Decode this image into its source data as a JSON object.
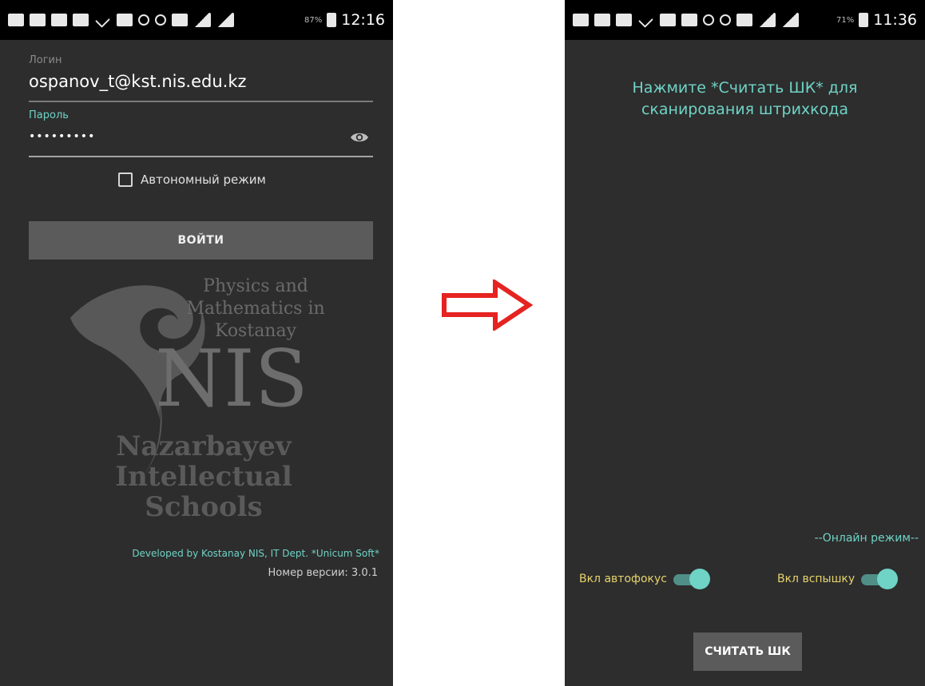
{
  "colors": {
    "background": "#2d2d2d",
    "accent_teal": "#6fd3c6",
    "toggle_label_yellow": "#e6d36d",
    "button_gray": "#5b5b5b",
    "arrow_red": "#e52321"
  },
  "left_screen": {
    "status_bar": {
      "time": "12:16",
      "battery": "87%"
    },
    "login": {
      "label": "Логин",
      "value": "ospanov_t@kst.nis.edu.kz"
    },
    "password": {
      "label": "Пароль",
      "value": "•••••••••",
      "visibility_icon": "eye-icon"
    },
    "offline_mode": {
      "label": "Автономный режим",
      "checked": false
    },
    "login_button": {
      "label": "ВОЙТИ"
    },
    "logo": {
      "physics_text": "Physics and Mathematics in Kostanay",
      "nis_text": "NIS",
      "nazarbayev_text": "Nazarbayev Intellectual Schools"
    },
    "footer": {
      "developed_by": "Developed by Kostanay NIS, IT Dept. *Unicum Soft*",
      "version": "Номер версии: 3.0.1"
    }
  },
  "arrow": {
    "icon": "right-arrow-icon"
  },
  "right_screen": {
    "status_bar": {
      "time": "11:36",
      "battery": "71%"
    },
    "instruction": "Нажмите *Считать ШК* для\nсканирования штрихкода",
    "online_mode": "--Онлайн режим--",
    "autofocus": {
      "label": "Вкл автофокус",
      "on": true
    },
    "flash": {
      "label": "Вкл вспышку",
      "on": true
    },
    "scan_button": {
      "label": "СЧИТАТЬ ШК"
    }
  }
}
